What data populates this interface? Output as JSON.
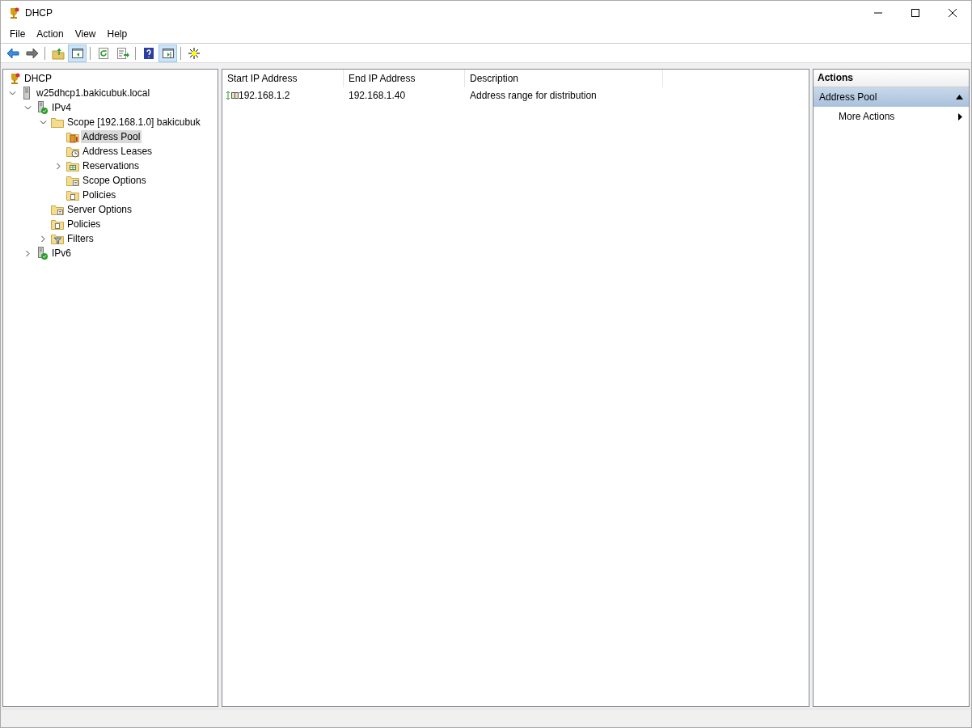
{
  "window": {
    "title": "DHCP"
  },
  "menu": [
    "File",
    "Action",
    "View",
    "Help"
  ],
  "toolbar": [
    {
      "kind": "back",
      "pressed": false
    },
    {
      "kind": "forward",
      "pressed": false
    },
    {
      "kind": "sep"
    },
    {
      "kind": "up",
      "pressed": false
    },
    {
      "kind": "tree",
      "pressed": true
    },
    {
      "kind": "sep"
    },
    {
      "kind": "refresh",
      "pressed": false
    },
    {
      "kind": "export",
      "pressed": false
    },
    {
      "kind": "sep"
    },
    {
      "kind": "help",
      "pressed": false
    },
    {
      "kind": "actionpane",
      "pressed": true
    },
    {
      "kind": "sep"
    },
    {
      "kind": "star",
      "pressed": false
    }
  ],
  "tree": [
    {
      "label": "DHCP",
      "kind": "trophy",
      "selected": false,
      "children": [
        {
          "label": "w25dhcp1.bakicubuk.local",
          "kind": "server",
          "expanded": true,
          "selected": false,
          "children": [
            {
              "label": "IPv4",
              "kind": "serverok",
              "expanded": true,
              "selected": false,
              "children": [
                {
                  "label": "Scope [192.168.1.0] bakicubuk",
                  "kind": "folder",
                  "expanded": true,
                  "selected": false,
                  "children": [
                    {
                      "label": "Address Pool",
                      "kind": "pool",
                      "selected": true
                    },
                    {
                      "label": "Address Leases",
                      "kind": "leases",
                      "selected": false
                    },
                    {
                      "label": "Reservations",
                      "kind": "grid",
                      "expanded": false,
                      "selected": false
                    },
                    {
                      "label": "Scope Options",
                      "kind": "options",
                      "selected": false
                    },
                    {
                      "label": "Policies",
                      "kind": "policy",
                      "selected": false
                    }
                  ]
                },
                {
                  "label": "Server Options",
                  "kind": "options",
                  "selected": false
                },
                {
                  "label": "Policies",
                  "kind": "policy",
                  "selected": false
                },
                {
                  "label": "Filters",
                  "kind": "filter",
                  "expanded": false,
                  "selected": false
                }
              ]
            },
            {
              "label": "IPv6",
              "kind": "serverok",
              "expanded": false,
              "selected": false
            }
          ]
        }
      ]
    }
  ],
  "table": {
    "columns": [
      "Start IP Address",
      "End IP Address",
      "Description"
    ],
    "rows": [
      [
        "192.168.1.2",
        "192.168.1.40",
        "Address range for distribution"
      ]
    ]
  },
  "actions": {
    "title": "Actions",
    "section": "Address Pool",
    "items": [
      "More Actions"
    ]
  }
}
